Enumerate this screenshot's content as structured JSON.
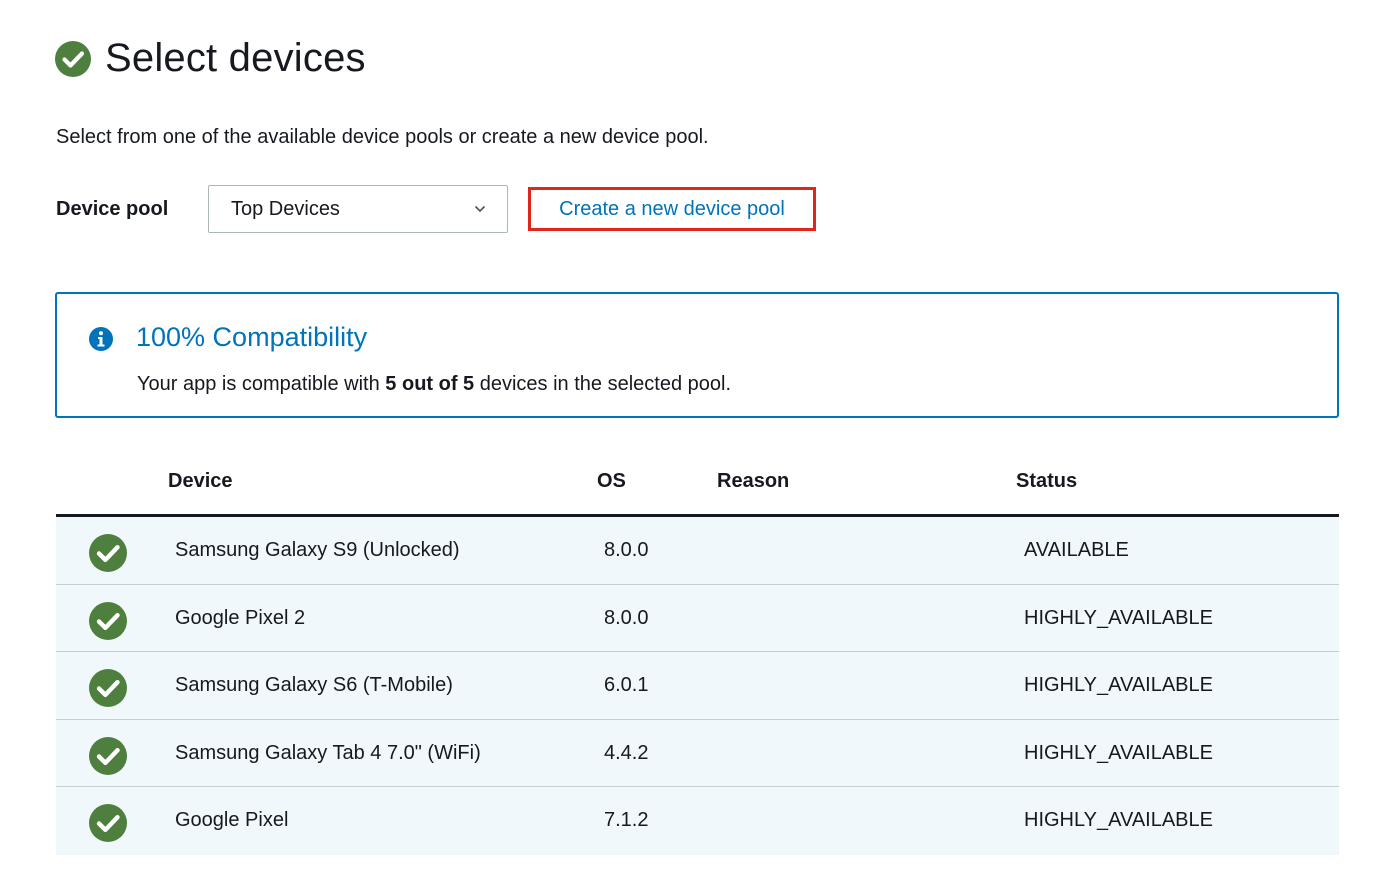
{
  "header": {
    "title": "Select devices",
    "icon": "check-circle-icon",
    "icon_color": "#4e7f3e"
  },
  "description": "Select from one of the available device pools or create a new device pool.",
  "pool": {
    "label": "Device pool",
    "selected": "Top Devices",
    "create_link": "Create a new device pool"
  },
  "compatibility": {
    "title": "100% Compatibility",
    "text_prefix": "Your app is compatible with ",
    "text_bold": "5 out of 5",
    "text_suffix": " devices in the selected pool.",
    "accent": "#0073bb"
  },
  "table": {
    "headers": {
      "device": "Device",
      "os": "OS",
      "reason": "Reason",
      "status": "Status"
    },
    "rows": [
      {
        "device": "Samsung Galaxy S9 (Unlocked)",
        "os": "8.0.0",
        "reason": "",
        "status": "AVAILABLE"
      },
      {
        "device": "Google Pixel 2",
        "os": "8.0.0",
        "reason": "",
        "status": "HIGHLY_AVAILABLE"
      },
      {
        "device": "Samsung Galaxy S6 (T-Mobile)",
        "os": "6.0.1",
        "reason": "",
        "status": "HIGHLY_AVAILABLE"
      },
      {
        "device": "Samsung Galaxy Tab 4 7.0\" (WiFi)",
        "os": "4.4.2",
        "reason": "",
        "status": "HIGHLY_AVAILABLE"
      },
      {
        "device": "Google Pixel",
        "os": "7.1.2",
        "reason": "",
        "status": "HIGHLY_AVAILABLE"
      }
    ]
  },
  "colors": {
    "success_green": "#4e7f3e",
    "link_blue": "#0073bb",
    "highlight_red": "#e0251b",
    "row_bg": "#f1f8fb"
  }
}
